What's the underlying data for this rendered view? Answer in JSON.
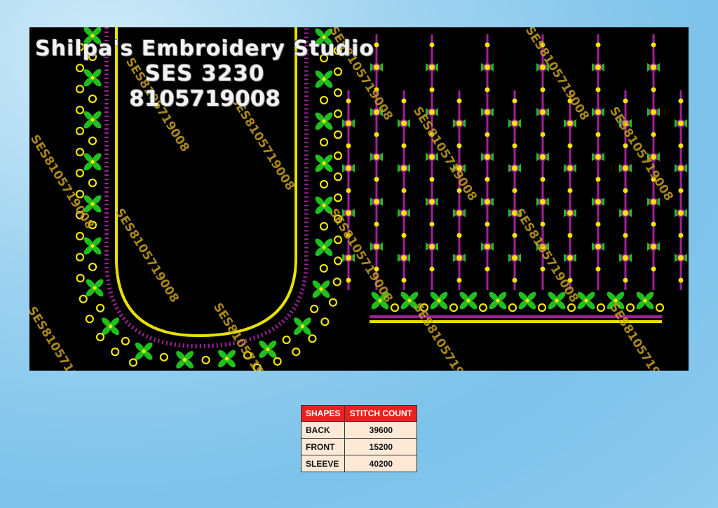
{
  "design": {
    "title": "Shilpa's Embroidery Studio",
    "code": "SES  3230",
    "phone": "8105719008",
    "watermark": "SES8105719008",
    "colors": {
      "background": "#000000",
      "leaf": "#1fbf1f",
      "bead": "#f2e600",
      "purple": "#a0209a",
      "yellow_line": "#e8e000"
    }
  },
  "stitch_table": {
    "headers": [
      "SHAPES",
      "STITCH COUNT"
    ],
    "rows": [
      {
        "shape": "BACK",
        "count": "39600"
      },
      {
        "shape": "FRONT",
        "count": "15200"
      },
      {
        "shape": "SLEEVE",
        "count": "40200"
      }
    ]
  }
}
